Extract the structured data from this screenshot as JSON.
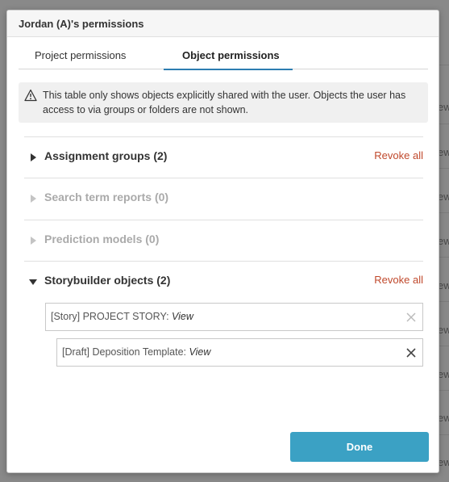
{
  "background": {
    "edge_text": [
      "ew",
      "ew",
      "ew",
      "ew",
      "ew",
      "ew",
      "ew",
      "ew",
      "ew",
      "ew"
    ]
  },
  "modal": {
    "title": "Jordan (A)'s permissions",
    "tabs": [
      {
        "label": "Project permissions",
        "active": false
      },
      {
        "label": "Object permissions",
        "active": true
      }
    ],
    "notice": {
      "icon": "warning-triangle-icon",
      "text": "This table only shows objects explicitly shared with the user. Objects the user has access to via groups or folders are not shown."
    },
    "sections": [
      {
        "title": "Assignment groups (2)",
        "expanded": false,
        "disabled": false,
        "revoke_label": "Revoke all"
      },
      {
        "title": "Search term reports (0)",
        "expanded": false,
        "disabled": true
      },
      {
        "title": "Prediction models (0)",
        "expanded": false,
        "disabled": true
      },
      {
        "title": "Storybuilder objects (2)",
        "expanded": true,
        "disabled": false,
        "revoke_label": "Revoke all"
      }
    ],
    "storybuilder_items": [
      {
        "prefix": "[Story] PROJECT STORY: ",
        "permission": "View",
        "remove_active": false
      },
      {
        "prefix": "[Draft] Deposition Template: ",
        "permission": "View",
        "remove_active": true
      }
    ],
    "done_label": "Done"
  },
  "colors": {
    "accent": "#2c7db1",
    "button": "#3ba1c4",
    "revoke": "#c0492c"
  }
}
